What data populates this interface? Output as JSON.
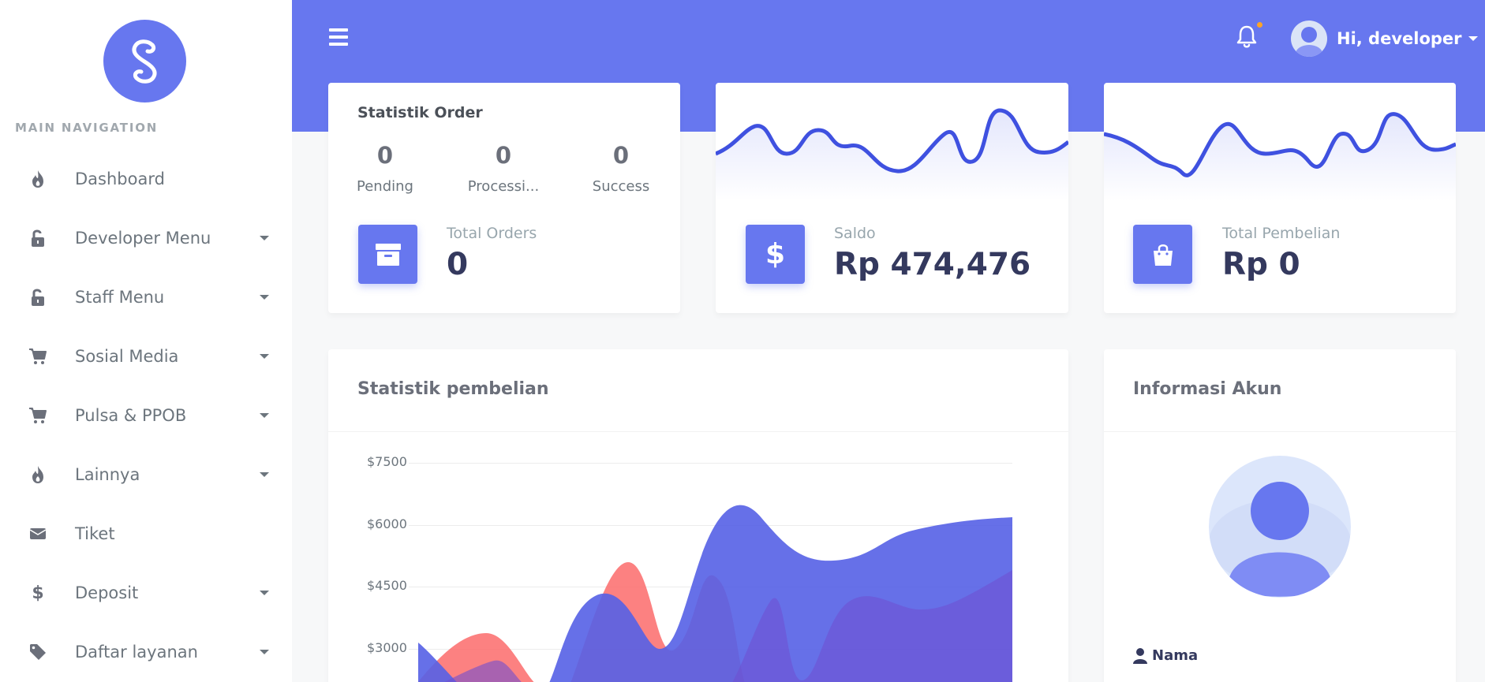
{
  "sidebar": {
    "nav_header": "MAIN NAVIGATION",
    "items": [
      {
        "label": "Dashboard",
        "icon": "fire-icon",
        "has_caret": false
      },
      {
        "label": "Developer Menu",
        "icon": "unlock-icon",
        "has_caret": true
      },
      {
        "label": "Staff Menu",
        "icon": "unlock-icon",
        "has_caret": true
      },
      {
        "label": "Sosial Media",
        "icon": "cart-icon",
        "has_caret": true
      },
      {
        "label": "Pulsa & PPOB",
        "icon": "cart-icon",
        "has_caret": true
      },
      {
        "label": "Lainnya",
        "icon": "fire-icon",
        "has_caret": true
      },
      {
        "label": "Tiket",
        "icon": "envelope-icon",
        "has_caret": false
      },
      {
        "label": "Deposit",
        "icon": "dollar-icon",
        "has_caret": true
      },
      {
        "label": "Daftar layanan",
        "icon": "tag-icon",
        "has_caret": true
      }
    ]
  },
  "header": {
    "greeting": "Hi, developer"
  },
  "order_card": {
    "title": "Statistik Order",
    "stats": [
      {
        "value": "0",
        "label": "Pending"
      },
      {
        "value": "0",
        "label": "Processi..."
      },
      {
        "value": "0",
        "label": "Success"
      }
    ],
    "total_caption": "Total Orders",
    "total_value": "0"
  },
  "saldo_card": {
    "caption": "Saldo",
    "value": "Rp 474,476"
  },
  "pembelian_card": {
    "caption": "Total Pembelian",
    "value": "Rp 0"
  },
  "purchase_chart": {
    "title": "Statistik pembelian",
    "y_ticks": [
      "$7500",
      "$6000",
      "$4500",
      "$3000"
    ]
  },
  "account_card": {
    "title": "Informasi Akun",
    "nama_label": "Nama"
  },
  "colors": {
    "primary": "#6777ef",
    "chart_red": "#fc6b6b",
    "chart_blue": "#5561e6",
    "chart_purple": "#6f4fd0"
  }
}
